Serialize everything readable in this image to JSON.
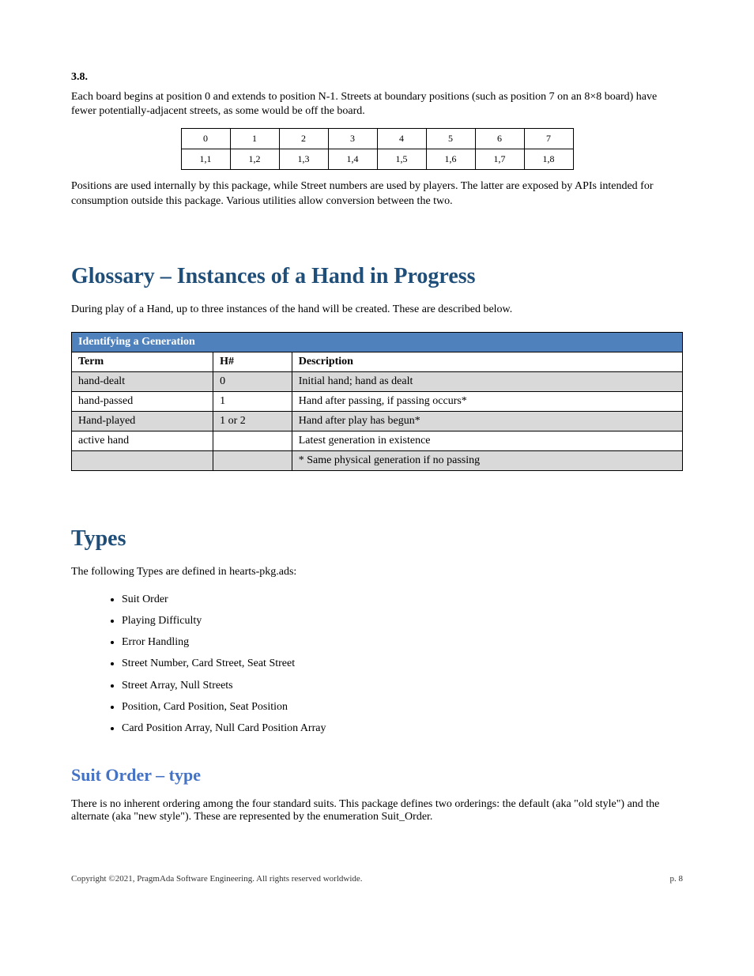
{
  "top": {
    "sectionLabel": "3.8.",
    "para1": "Each board begins at position 0 and extends to position N-1. Streets at boundary positions (such as position 7 on an 8×8 board) have fewer potentially-adjacent streets, as some would be off the board.",
    "exampleRow1": [
      "0",
      "1",
      "2",
      "3",
      "4",
      "5",
      "6",
      "7"
    ],
    "exampleRow2": [
      "1,1",
      "1,2",
      "1,3",
      "1,4",
      "1,5",
      "1,6",
      "1,7",
      "1,8"
    ],
    "para2": "Positions are used internally by this package, while Street numbers are used by players. The latter are exposed by APIs intended for consumption outside this package. Various utilities allow conversion between the two."
  },
  "glossary": {
    "heading": "Glossary – Instances of a Hand in Progress",
    "intro": "During play of a Hand, up to three instances of the hand will be created. These are described below.",
    "headerBand": "Identifying a Generation",
    "columns": [
      "Term",
      "H#",
      "Description"
    ],
    "rows": [
      [
        "hand-dealt",
        "0",
        "Initial hand; hand as dealt"
      ],
      [
        "hand-passed",
        "1",
        "Hand after passing, if passing occurs*"
      ],
      [
        "Hand-played",
        "1 or 2",
        "Hand after play has begun*"
      ],
      [
        "active hand",
        "",
        "Latest generation in existence"
      ],
      [
        "",
        "",
        "* Same physical generation if no passing"
      ]
    ]
  },
  "types": {
    "heading": "Types",
    "intro": "The following Types are defined in hearts-pkg.ads:",
    "items": [
      "Suit Order",
      "Playing Difficulty",
      "Error Handling",
      "Street Number, Card Street, Seat Street",
      "Street Array, Null Streets",
      "Position, Card Position, Seat Position",
      "Card Position Array, Null Card Position Array"
    ],
    "subheading": "Suit Order – type",
    "body": "There is no inherent ordering among the four standard suits. This package defines two orderings: the default (aka \"old style\") and the alternate (aka \"new style\"). These are represented by the enumeration Suit_Order."
  },
  "footer": {
    "left": "Copyright ©2021, PragmAda Software Engineering. All rights reserved worldwide.",
    "right": "p. 8"
  }
}
